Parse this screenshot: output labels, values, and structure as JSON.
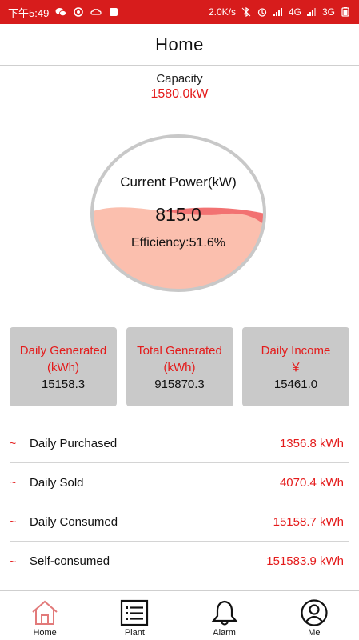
{
  "status_bar": {
    "time": "下午5:49",
    "speed": "2.0K/s",
    "network_1": "4G",
    "network_2": "3G"
  },
  "header": {
    "title": "Home"
  },
  "capacity": {
    "label": "Capacity",
    "value": "1580.0kW"
  },
  "gauge": {
    "title": "Current Power(kW)",
    "value": "815.0",
    "efficiency": "Efficiency:51.6%",
    "fill_fraction": 0.516,
    "colors": {
      "fill": "#fbbfae",
      "wave": "#f27272",
      "ring": "#c8c8c8"
    }
  },
  "cards": [
    {
      "label_line1": "Daily Generated",
      "label_line2": "(kWh)",
      "value": "15158.3"
    },
    {
      "label_line1": "Total Generated",
      "label_line2": "(kWh)",
      "value": "915870.3"
    },
    {
      "label_line1": "Daily Income",
      "label_line2": "￥",
      "value": "15461.0"
    }
  ],
  "stats": [
    {
      "marker": "~",
      "label": "Daily Purchased",
      "value": "1356.8 kWh"
    },
    {
      "marker": "~",
      "label": "Daily Sold",
      "value": "4070.4 kWh"
    },
    {
      "marker": "~",
      "label": "Daily Consumed",
      "value": "15158.7 kWh"
    },
    {
      "marker": "~",
      "label": "Self-consumed",
      "value": "151583.9 kWh"
    }
  ],
  "tabs": [
    {
      "label": "Home",
      "icon": "home-icon",
      "active": true
    },
    {
      "label": "Plant",
      "icon": "list-icon",
      "active": false
    },
    {
      "label": "Alarm",
      "icon": "bell-icon",
      "active": false
    },
    {
      "label": "Me",
      "icon": "user-icon",
      "active": false
    }
  ],
  "colors": {
    "accent": "#e41b1b",
    "status_bar": "#d71c1c",
    "card_bg": "#c9c9c9"
  }
}
